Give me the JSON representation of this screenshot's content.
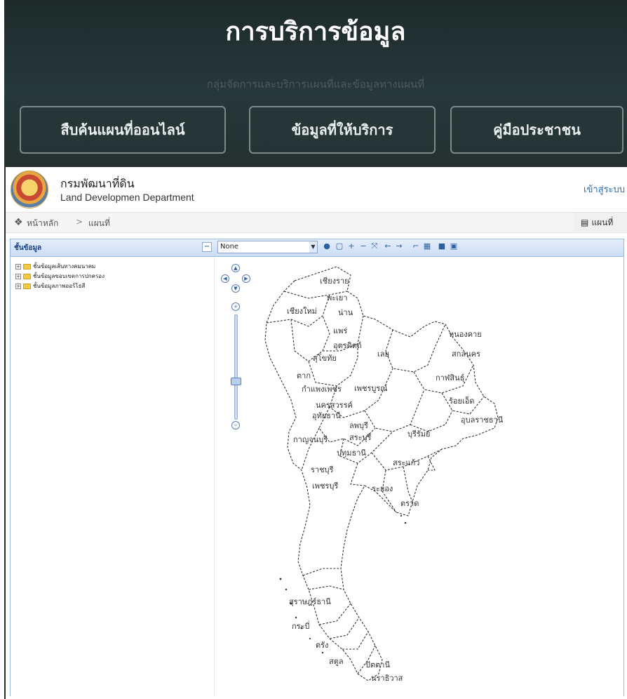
{
  "hero": {
    "title": "การบริการข้อมูล",
    "subtitle": "กลุ่มจัดการและบริการแผนที่และข้อมูลทางแผนที่",
    "buttons": [
      "สืบค้นแผนที่ออนไลน์",
      "ข้อมูลที่ให้บริการ",
      "คู่มือประชาชน"
    ]
  },
  "header": {
    "org_name_th": "กรมพัฒนาที่ดิน",
    "org_name_en": "Land Developmen Department",
    "login_link": "เข้าสู่ระบบ"
  },
  "breadcrumb": {
    "home": "หน้าหลัก",
    "separator": ">",
    "current": "แผนที่",
    "map_tab_label": "แผนที่"
  },
  "layer_panel": {
    "title": "ชั้นข้อมูล",
    "select_value": "None",
    "tree_items": [
      "ชั้นข้อมูลเส้นทางคมนาคม",
      "ชั้นข้อมูลขอบเขตการปกครอง",
      "ชั้นข้อมูลภาพออร์โธสี"
    ]
  },
  "map": {
    "province_labels": [
      "เชียงราย",
      "พะเยา",
      "เชียงใหม่",
      "น่าน",
      "แพร่",
      "อุตรดิตถ์",
      "สุโขทัย",
      "เลย",
      "หนองคาย",
      "สกลนคร",
      "ตาก",
      "กำแพงเพชร",
      "เพชรบูรณ์",
      "กาฬสินธุ์",
      "นครสวรรค์",
      "ร้อยเอ็ด",
      "อุทัยธานี",
      "ลพบุรี",
      "อุบลราชธานี",
      "สระบุรี",
      "บุรีรัมย์",
      "กาญจนบุรี",
      "ปทุมธานี",
      "สระแก้ว",
      "ราชบุรี",
      "เพชรบุรี",
      "ระยอง",
      "ตราด",
      "สุราษฎร์ธานี",
      "กระบี่",
      "ตรัง",
      "สตูล",
      "ปัตตานี",
      "นราธิวาส"
    ]
  },
  "icons": {
    "home": "home-icon",
    "map_tab": "map-icon"
  },
  "colors": {
    "hero_bg": "#22302f",
    "link": "#2d6db3",
    "panel_header": "#cbdcf3"
  }
}
